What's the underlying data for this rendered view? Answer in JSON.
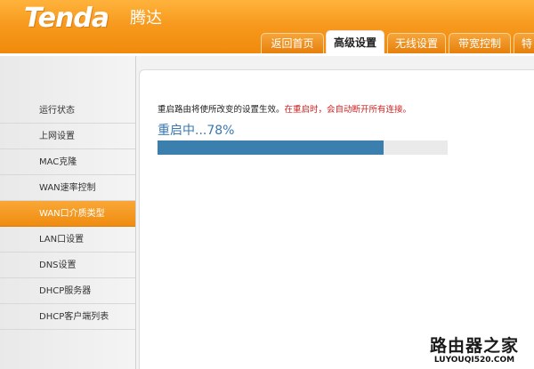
{
  "brand": {
    "logo": "Tenda",
    "logo_cn": "腾达"
  },
  "tabs": [
    {
      "label": "返回首页",
      "active": false
    },
    {
      "label": "高级设置",
      "active": true
    },
    {
      "label": "无线设置",
      "active": false
    },
    {
      "label": "带宽控制",
      "active": false
    },
    {
      "label": "特",
      "active": false
    }
  ],
  "sidebar": {
    "items": [
      {
        "label": "运行状态",
        "active": false
      },
      {
        "label": "上网设置",
        "active": false
      },
      {
        "label": "MAC克隆",
        "active": false
      },
      {
        "label": "WAN速率控制",
        "active": false
      },
      {
        "label": "WAN口介质类型",
        "active": true
      },
      {
        "label": "LAN口设置",
        "active": false
      },
      {
        "label": "DNS设置",
        "active": false
      },
      {
        "label": "DHCP服务器",
        "active": false
      },
      {
        "label": "DHCP客户端列表",
        "active": false
      }
    ]
  },
  "main": {
    "notice": "重启路由将使所改变的设置生效。",
    "warning": "在重启时，会自动断开所有连接。",
    "progress_label": "重启中...78%",
    "progress_fraction": 0.78
  },
  "watermark": {
    "cn": "路由器之家",
    "en": "LUYOUQI520.COM"
  },
  "colors": {
    "header_orange": "#f79a1e",
    "active_item": "#f08c10",
    "progress_fill": "#3a7fae",
    "progress_text": "#3a78b0",
    "warning_text": "#d21f1f"
  }
}
